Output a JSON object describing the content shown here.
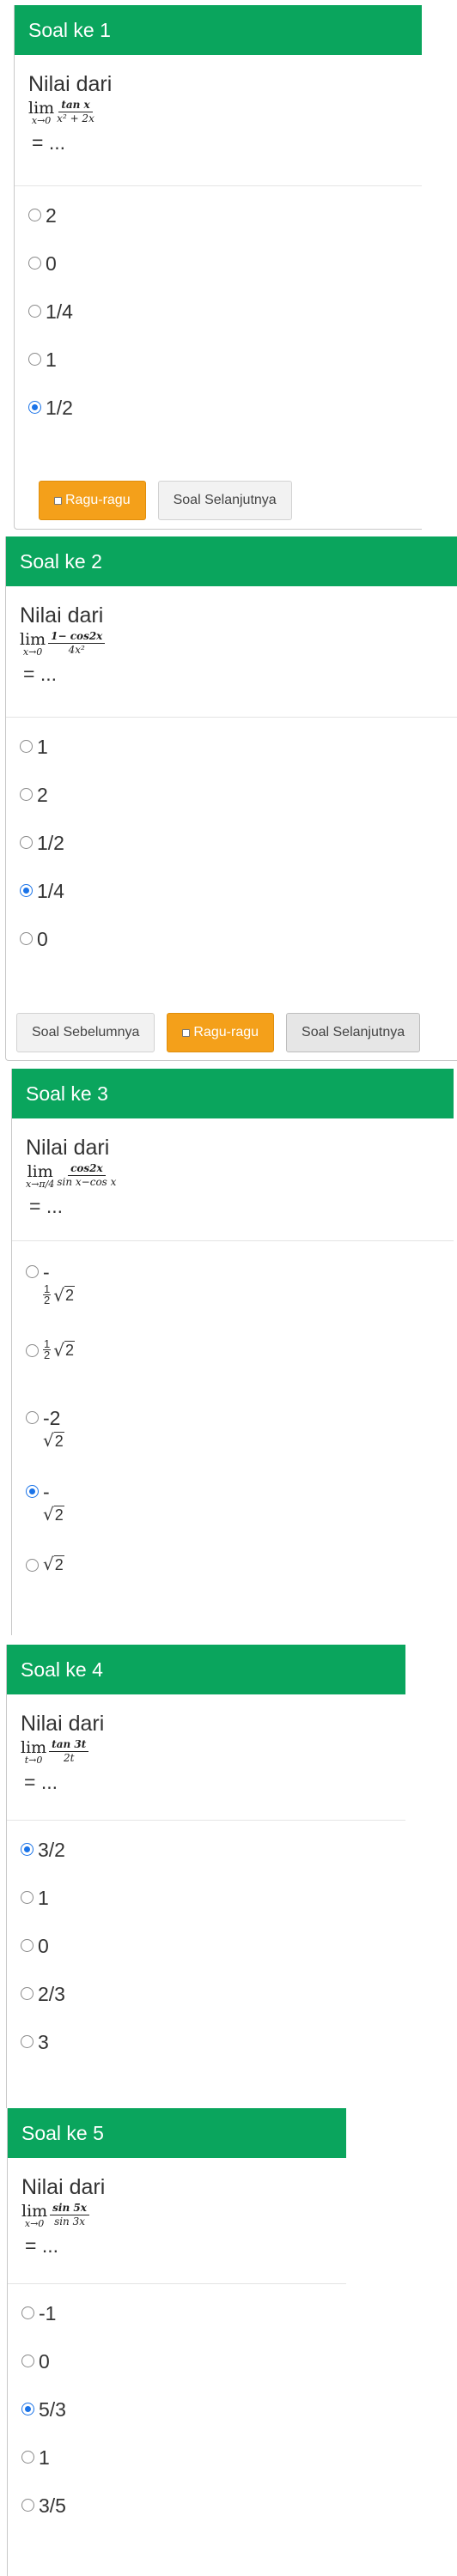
{
  "q1": {
    "header": "Soal ke 1",
    "prefix": "Nilai dari",
    "lim_word": "lim",
    "lim_sub": "x→0",
    "numerator": "tan x",
    "denominator": "x² + 2x",
    "suffix": "= ...",
    "options": [
      "2",
      "0",
      "1/4",
      "1",
      "1/2"
    ],
    "ragu_label": "Ragu-ragu",
    "next_label": "Soal Selanjutnya"
  },
  "q2": {
    "header": "Soal ke 2",
    "prefix": "Nilai dari",
    "lim_word": "lim",
    "lim_sub": "x→0",
    "numerator": "1− cos2x",
    "denominator": "4x²",
    "suffix": "= ...",
    "options": [
      "1",
      "2",
      "1/2",
      "1/4",
      "0"
    ],
    "prev_label": "Soal Sebelumnya",
    "ragu_label": "Ragu-ragu",
    "next_label": "Soal Selanjutnya"
  },
  "q3": {
    "header": "Soal ke 3",
    "prefix": "Nilai dari",
    "lim_word": "lim",
    "lim_sub": "x→π/4",
    "numerator": "cos2x",
    "denominator": "sin x−cos x",
    "suffix": "= ...",
    "options": {
      "a_sign": "-",
      "a_frac_num": "1",
      "a_frac_den": "2",
      "a_radical": "2",
      "b_frac_num": "1",
      "b_frac_den": "2",
      "b_radical": "2",
      "c_text": "-2",
      "c_radical": "2",
      "d_sign": "-",
      "d_radical": "2",
      "e_radical": "2"
    }
  },
  "q4": {
    "header": "Soal ke 4",
    "prefix": "Nilai dari",
    "lim_word": "lim",
    "lim_sub": "t→0",
    "numerator": "tan 3t",
    "denominator": "2t",
    "suffix": "= ...",
    "options": [
      "3/2",
      "1",
      "0",
      "2/3",
      "3"
    ]
  },
  "q5": {
    "header": "Soal ke 5",
    "prefix": "Nilai dari",
    "lim_word": "lim",
    "lim_sub": "x→0",
    "numerator": "sin 5x",
    "denominator": "sin 3x",
    "suffix": "= ...",
    "options": [
      "-1",
      "0",
      "5/3",
      "1",
      "3/5"
    ]
  },
  "colors": {
    "header_green": "#0aa55d",
    "ragu_orange": "#f4a01a",
    "radio_blue": "#1a73e8"
  },
  "icons": {
    "radio": "radio-icon",
    "checkbox": "checkbox-icon",
    "sqrt": "√"
  }
}
